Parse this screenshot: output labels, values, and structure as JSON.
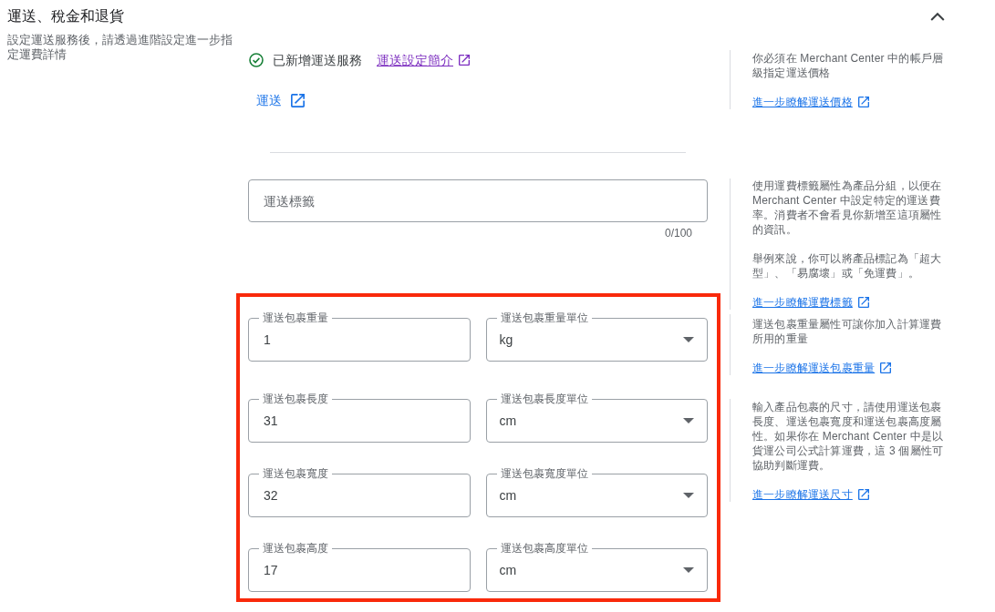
{
  "section": {
    "title": "運送、稅金和退貨",
    "description": "設定運送服務後，請透過進階設定進一步指定運費詳情",
    "expanded": true
  },
  "shipping_service": {
    "status": "已新增運送服務",
    "link": {
      "label": "運送設定簡介",
      "visited": true
    },
    "button": {
      "label": "運送"
    }
  },
  "shipping_label_field": {
    "placeholder": "運送標籤",
    "counter": "0/100"
  },
  "package_fields": {
    "highlighted": true,
    "groups": [
      {
        "rows": [
          [
            {
              "kind": "number",
              "label": "運送包裹重量",
              "value": "1"
            },
            {
              "kind": "dropdown",
              "label": "運送包裹重量單位",
              "value": "kg"
            }
          ]
        ]
      },
      {
        "rows": [
          [
            {
              "kind": "number",
              "label": "運送包裹長度",
              "value": "31"
            },
            {
              "kind": "dropdown",
              "label": "運送包裹長度單位",
              "value": "cm"
            }
          ],
          [
            {
              "kind": "number",
              "label": "運送包裹寬度",
              "value": "32"
            },
            {
              "kind": "dropdown",
              "label": "運送包裹寬度單位",
              "value": "cm"
            }
          ],
          [
            {
              "kind": "number",
              "label": "運送包裹高度",
              "value": "17"
            },
            {
              "kind": "dropdown",
              "label": "運送包裹高度單位",
              "value": "cm"
            }
          ]
        ]
      }
    ]
  },
  "help": [
    {
      "paragraphs": [
        "你必須在 Merchant Center 中的帳戶層級指定運送價格"
      ],
      "link": {
        "label": "進一步瞭解運送價格",
        "visited": false
      }
    },
    {
      "paragraphs": [
        "使用運費標籤屬性為產品分組，以便在 Merchant Center 中設定特定的運送費率。消費者不會看見你新增至這項屬性的資訊。",
        "舉例來說，你可以將產品標記為「超大型」、「易腐壞」或「免運費」。"
      ],
      "link": {
        "label": "進一步瞭解運費標籤",
        "visited": false
      }
    },
    {
      "paragraphs": [
        "運送包裹重量屬性可讓你加入計算運費所用的重量"
      ],
      "link": {
        "label": "進一步瞭解運送包裹重量",
        "visited": false
      }
    },
    {
      "paragraphs": [
        "輸入產品包裹的尺寸，請使用運送包裹長度、運送包裹寬度和運送包裹高度屬性。如果你在 Merchant Center 中是以貨運公司公式計算運費，這 3 個屬性可協助判斷運費。"
      ],
      "link": {
        "label": "進一步瞭解運送尺寸",
        "visited": false
      }
    }
  ]
}
